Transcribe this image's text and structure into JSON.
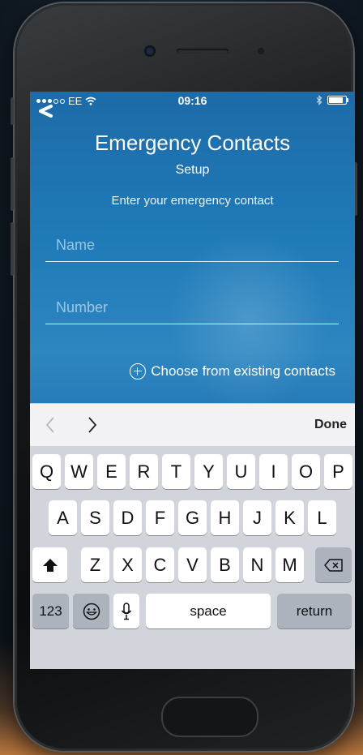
{
  "status_bar": {
    "carrier": "EE",
    "time": "09:16"
  },
  "header": {
    "title": "Emergency Contacts",
    "subtitle": "Setup",
    "prompt": "Enter your emergency contact"
  },
  "form": {
    "name_placeholder": "Name",
    "number_placeholder": "Number",
    "choose_existing_label": "Choose from existing contacts"
  },
  "accessory": {
    "done_label": "Done"
  },
  "keyboard": {
    "row1": [
      "Q",
      "W",
      "E",
      "R",
      "T",
      "Y",
      "U",
      "I",
      "O",
      "P"
    ],
    "row2": [
      "A",
      "S",
      "D",
      "F",
      "G",
      "H",
      "J",
      "K",
      "L"
    ],
    "row3": [
      "Z",
      "X",
      "C",
      "V",
      "B",
      "N",
      "M"
    ],
    "numbers_label": "123",
    "space_label": "space",
    "return_label": "return"
  },
  "colors": {
    "screen_gradient_top": "#1d6ba8",
    "screen_gradient_bottom": "#1a5f98",
    "keyboard_bg": "#d1d4da"
  }
}
